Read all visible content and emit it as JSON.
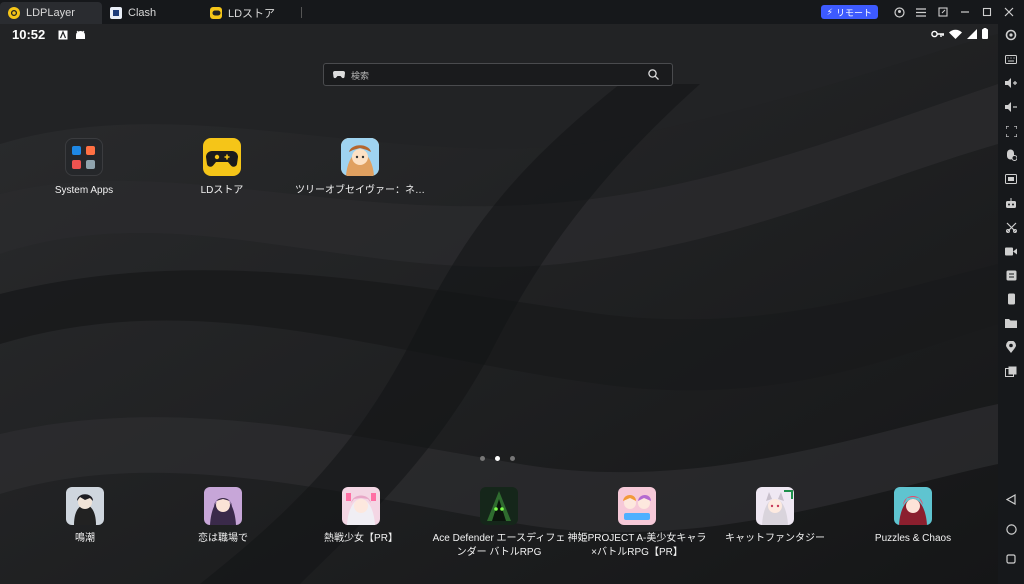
{
  "tabs": [
    {
      "label": "LDPLayer",
      "icon": "ldplayer-logo-icon"
    },
    {
      "label": "Clash",
      "icon": "clash-app-icon"
    },
    {
      "label": "LDストア",
      "icon": "ldstore-gamepad-icon"
    }
  ],
  "titlebar": {
    "remote_label": "リモート",
    "accent": "#3d5afe"
  },
  "statusbar": {
    "time": "10:52"
  },
  "search": {
    "placeholder": "検索"
  },
  "apps": [
    {
      "label": "System Apps",
      "icon": "system-apps-folder-icon"
    },
    {
      "label": "LDストア",
      "icon": "ldstore-icon"
    },
    {
      "label": "ツリーオブセイヴァー：ネ…",
      "icon": "tree-of-savior-icon"
    }
  ],
  "page_indicator": {
    "count": 3,
    "active": 2
  },
  "dock": [
    {
      "label": "鳴潮"
    },
    {
      "label": "恋は職場で"
    },
    {
      "label": "熱戦少女【PR】"
    },
    {
      "label": "Ace Defender エースディフェンダー バトルRPG"
    },
    {
      "label": "神姫PROJECT A-美少女キャラ×バトルRPG【PR】"
    },
    {
      "label": "キャットファンタジー"
    },
    {
      "label": "Puzzles & Chaos"
    }
  ],
  "colors": {
    "background": "#1e1f21",
    "titlebar": "#16181b",
    "ld_yellow": "#f5c518"
  }
}
